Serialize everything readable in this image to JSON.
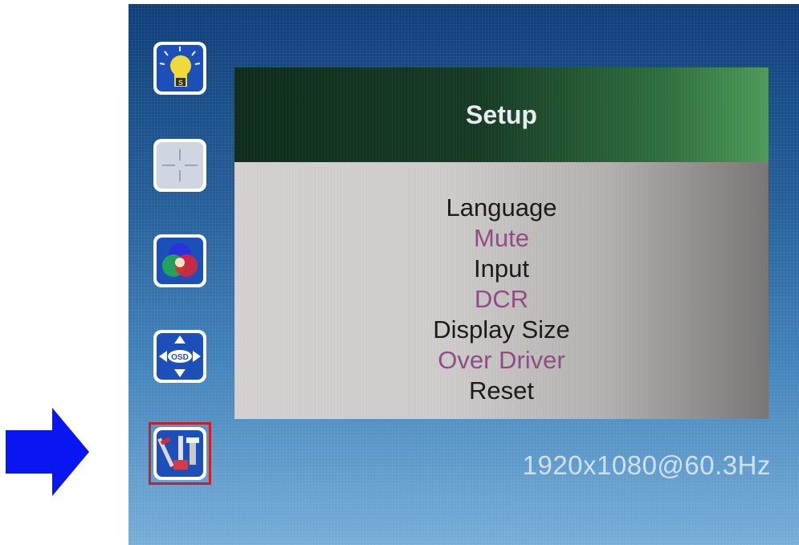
{
  "pointer": {
    "icon": "arrow-right-icon",
    "color": "#0a16f2"
  },
  "sidebar": {
    "items": [
      {
        "id": "brightness",
        "icon": "light-bulb-icon"
      },
      {
        "id": "position",
        "icon": "image-position-icon"
      },
      {
        "id": "color",
        "icon": "color-circles-icon"
      },
      {
        "id": "osd-position",
        "icon": "osd-move-icon",
        "icon_text": "OSD"
      },
      {
        "id": "setup",
        "icon": "tools-icon",
        "selected": true
      }
    ]
  },
  "panel": {
    "title": "Setup",
    "items": [
      {
        "label": "Language",
        "enabled": true
      },
      {
        "label": "Mute",
        "enabled": false
      },
      {
        "label": "Input",
        "enabled": true
      },
      {
        "label": "DCR",
        "enabled": false
      },
      {
        "label": "Display Size",
        "enabled": true
      },
      {
        "label": "Over Driver",
        "enabled": false
      },
      {
        "label": "Reset",
        "enabled": true
      }
    ]
  },
  "status": {
    "resolution": "1920x1080@60.3Hz"
  },
  "colors": {
    "enabled_text": "#1b1b1b",
    "disabled_text": "#8f4d86",
    "selection_border": "#c8202a"
  }
}
